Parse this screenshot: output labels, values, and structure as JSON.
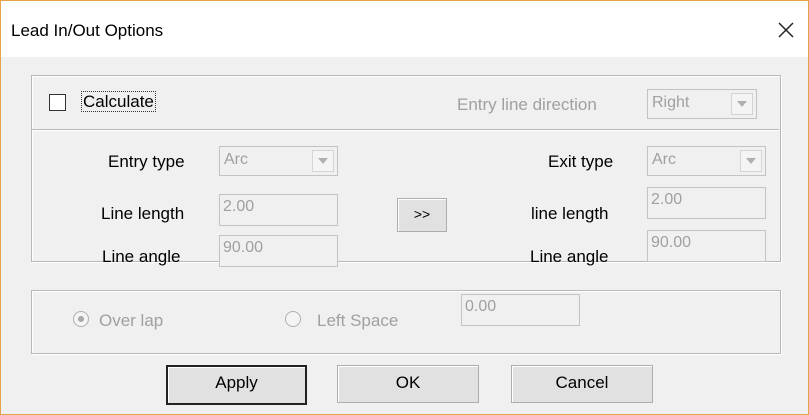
{
  "window": {
    "title": "Lead In/Out Options"
  },
  "top": {
    "calculate_label": "Calculate",
    "calculate_checked": false,
    "entry_direction_label": "Entry line direction",
    "entry_direction_value": "Right"
  },
  "entry": {
    "type_label": "Entry type",
    "type_value": "Arc",
    "length_label": "Line length",
    "length_value": "2.00",
    "angle_label": "Line angle",
    "angle_value": "90.00"
  },
  "copy_button_label": ">>",
  "exit": {
    "type_label": "Exit type",
    "type_value": "Arc",
    "length_label": "line length",
    "length_value": "2.00",
    "angle_label": "Line angle",
    "angle_value": "90.00"
  },
  "overlap": {
    "overlap_label": "Over lap",
    "left_space_label": "Left Space",
    "left_space_value": "0.00",
    "selected": "Over lap"
  },
  "buttons": {
    "apply": "Apply",
    "ok": "OK",
    "cancel": "Cancel"
  },
  "colors": {
    "disabled_text": "#a0a0a0",
    "window_border": "#e7a34a",
    "background": "#f0f0f0"
  },
  "icons": {
    "close": "close-icon",
    "dropdown": "chevron-down-icon"
  }
}
